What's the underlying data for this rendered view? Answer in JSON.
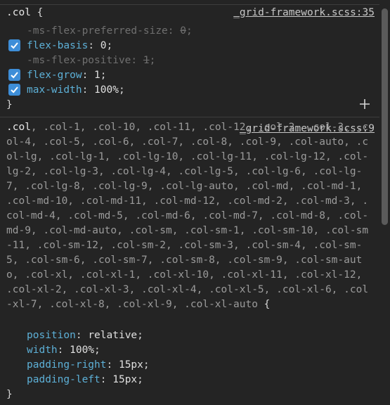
{
  "rule1": {
    "selector": ".col",
    "open_brace": " {",
    "source": "_grid-framework.scss:35",
    "declarations": [
      {
        "prop": "-ms-flex-preferred-size",
        "value": "0",
        "disabled": true
      },
      {
        "prop": "flex-basis",
        "value": "0",
        "disabled": false,
        "checked": true
      },
      {
        "prop": "-ms-flex-positive",
        "value": "1",
        "disabled": true
      },
      {
        "prop": "flex-grow",
        "value": "1",
        "disabled": false,
        "checked": true
      },
      {
        "prop": "max-width",
        "value": "100%",
        "disabled": false,
        "checked": true
      }
    ],
    "close_brace": "}",
    "add_label": "+"
  },
  "rule2": {
    "selector_active": ".col",
    "selector_rest": ", .col-1, .col-10, .col-11, .col-12, .col-2, .col-3, .col-4, .col-5, .col-6, .col-7, .col-8, .col-9, .col-auto, .col-lg, .col-lg-1, .col-lg-10, .col-lg-11, .col-lg-12, .col-lg-2, .col-lg-3, .col-lg-4, .col-lg-5, .col-lg-6, .col-lg-7, .col-lg-8, .col-lg-9, .col-lg-auto, .col-md, .col-md-1, .col-md-10, .col-md-11, .col-md-12, .col-md-2, .col-md-3, .col-md-4, .col-md-5, .col-md-6, .col-md-7, .col-md-8, .col-md-9, .col-md-auto, .col-sm, .col-sm-1, .col-sm-10, .col-sm-11, .col-sm-12, .col-sm-2, .col-sm-3, .col-sm-4, .col-sm-5, .col-sm-6, .col-sm-7, .col-sm-8, .col-sm-9, .col-sm-auto, .col-xl, .col-xl-1, .col-xl-10, .col-xl-11, .col-xl-12, .col-xl-2, .col-xl-3, .col-xl-4, .col-xl-5, .col-xl-6, .col-xl-7, .col-xl-8, .col-xl-9, .col-xl-auto",
    "open_brace": " {",
    "source": "_grid-framework.scss:9",
    "declarations": [
      {
        "prop": "position",
        "value": "relative"
      },
      {
        "prop": "width",
        "value": "100%"
      },
      {
        "prop": "padding-right",
        "value": "15px"
      },
      {
        "prop": "padding-left",
        "value": "15px"
      }
    ],
    "close_brace": "}"
  },
  "colors": {
    "background": "#242424",
    "property": "#5db0d7",
    "checkbox": "#3e8ed8",
    "disabled": "#6f6f6f"
  }
}
